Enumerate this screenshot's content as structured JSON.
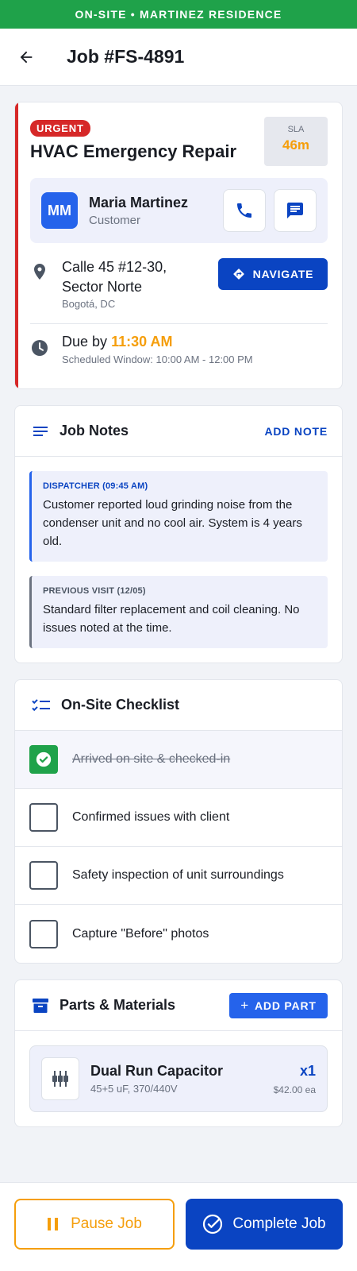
{
  "banner": {
    "text": "ON-SITE • MARTINEZ RESIDENCE"
  },
  "header": {
    "title": "Job #FS-4891"
  },
  "job": {
    "badge": "URGENT",
    "title": "HVAC Emergency Repair",
    "sla_label": "SLA",
    "sla_value": "46m",
    "customer": {
      "initials": "MM",
      "name": "Maria Martinez",
      "role": "Customer"
    },
    "address": {
      "line1": "Calle 45 #12-30,",
      "line2": "Sector Norte",
      "city": "Bogotá, DC"
    },
    "navigate_label": "NAVIGATE",
    "due": {
      "prefix": "Due by",
      "time": "11:30 AM",
      "window": "Scheduled Window: 10:00 AM - 12:00 PM"
    }
  },
  "notes": {
    "title": "Job Notes",
    "add_label": "ADD NOTE",
    "items": [
      {
        "header": "DISPATCHER (09:45 AM)",
        "text": "Customer reported loud grinding noise from the condenser unit and no cool air. System is 4 years old."
      },
      {
        "header": "PREVIOUS VISIT (12/05)",
        "text": "Standard filter replacement and coil cleaning. No issues noted at the time."
      }
    ]
  },
  "checklist": {
    "title": "On-Site Checklist",
    "items": [
      {
        "label": "Arrived on site & checked-in",
        "checked": true
      },
      {
        "label": "Confirmed issues with client",
        "checked": false
      },
      {
        "label": "Safety inspection of unit surroundings",
        "checked": false
      },
      {
        "label": "Capture \"Before\" photos",
        "checked": false
      }
    ]
  },
  "parts": {
    "title": "Parts & Materials",
    "add_label": "ADD PART",
    "items": [
      {
        "name": "Dual Run Capacitor",
        "spec": "45+5 uF, 370/440V",
        "qty": "x1",
        "price": "$42.00 ea"
      }
    ]
  },
  "actions": {
    "pause_label": "Pause Job",
    "complete_label": "Complete Job"
  },
  "colors": {
    "accent": "#0a44c2",
    "success": "#1fa24a",
    "urgent": "#d62828",
    "warning": "#f59e0b"
  }
}
